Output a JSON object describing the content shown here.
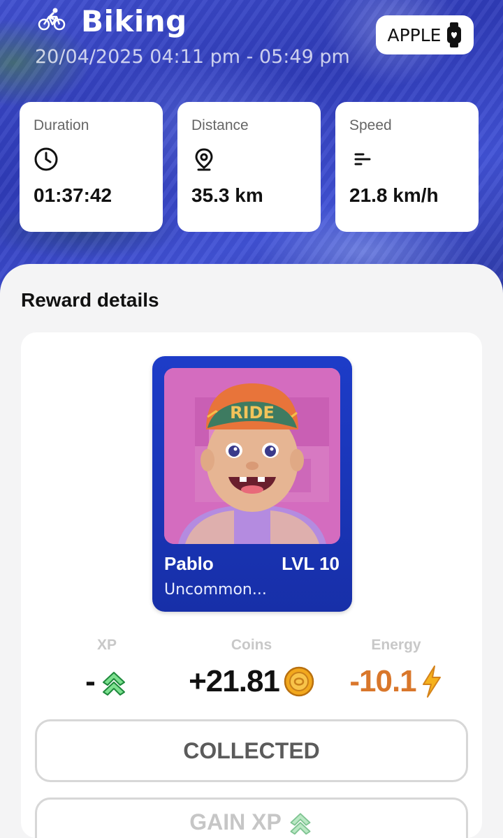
{
  "activity": {
    "title": "Biking",
    "time_range": "20/04/2025 04:11 pm - 05:49 pm",
    "icon": "bike-icon"
  },
  "device": {
    "label": "APPLE",
    "icon": "smartwatch-icon"
  },
  "stats": [
    {
      "label": "Duration",
      "value": "01:37:42",
      "icon": "clock-icon"
    },
    {
      "label": "Distance",
      "value": "35.3 km",
      "icon": "location-pin-icon"
    },
    {
      "label": "Speed",
      "value": "21.8 km/h",
      "icon": "speed-lines-icon"
    }
  ],
  "rewards": {
    "title": "Reward details",
    "card": {
      "name": "Pablo",
      "level": "LVL 10",
      "rarity": "Uncommon...",
      "hat_text": "RIDE"
    },
    "xp": {
      "label": "XP",
      "value": "-",
      "icon": "double-chevron-up-icon",
      "color": "#2fbf5a"
    },
    "coins": {
      "label": "Coins",
      "value": "+21.81",
      "icon": "coin-icon",
      "color": "#111111"
    },
    "energy": {
      "label": "Energy",
      "value": "-10.1",
      "icon": "lightning-icon",
      "color": "#d9772b"
    }
  },
  "buttons": {
    "collected": "COLLECTED",
    "gain_xp": "GAIN XP"
  },
  "colors": {
    "card_blue": "#1d3cc8",
    "energy_orange": "#d9772b",
    "xp_green": "#2fbf5a",
    "coin_gold": "#f2a81d"
  }
}
